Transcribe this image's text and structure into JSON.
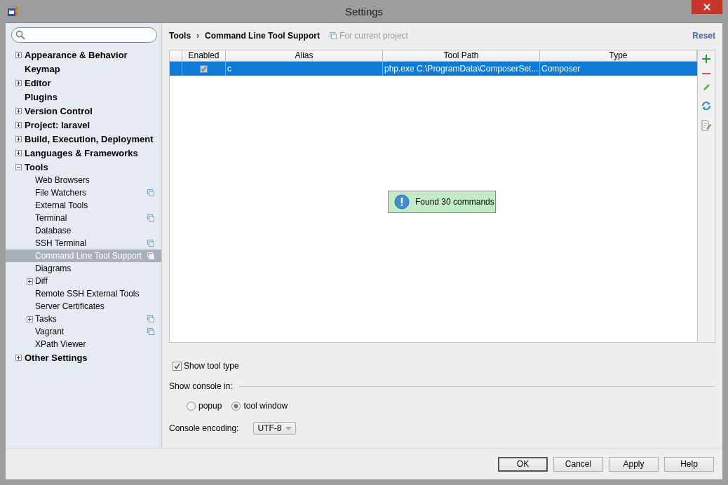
{
  "window": {
    "title": "Settings"
  },
  "sidebar": {
    "items": [
      {
        "label": "Appearance & Behavior",
        "kind": "group",
        "expanded": false,
        "selected": false
      },
      {
        "label": "Keymap",
        "kind": "leaf",
        "selected": false
      },
      {
        "label": "Editor",
        "kind": "group",
        "expanded": false,
        "selected": false
      },
      {
        "label": "Plugins",
        "kind": "leaf",
        "selected": false
      },
      {
        "label": "Version Control",
        "kind": "group",
        "expanded": false,
        "selected": false
      },
      {
        "label": "Project: laravel",
        "kind": "group",
        "expanded": false,
        "selected": false
      },
      {
        "label": "Build, Execution, Deployment",
        "kind": "group",
        "expanded": false,
        "selected": false
      },
      {
        "label": "Languages & Frameworks",
        "kind": "group",
        "expanded": false,
        "selected": false
      },
      {
        "label": "Tools",
        "kind": "group",
        "expanded": true,
        "selected": false,
        "children": [
          {
            "label": "Web Browsers",
            "kind": "leaf",
            "selected": false,
            "per_project": false
          },
          {
            "label": "File Watchers",
            "kind": "leaf",
            "selected": false,
            "per_project": true
          },
          {
            "label": "External Tools",
            "kind": "leaf",
            "selected": false,
            "per_project": false
          },
          {
            "label": "Terminal",
            "kind": "leaf",
            "selected": false,
            "per_project": true
          },
          {
            "label": "Database",
            "kind": "leaf",
            "selected": false,
            "per_project": false
          },
          {
            "label": "SSH Terminal",
            "kind": "leaf",
            "selected": false,
            "per_project": true
          },
          {
            "label": "Command Line Tool Support",
            "kind": "leaf",
            "selected": true,
            "per_project": true
          },
          {
            "label": "Diagrams",
            "kind": "leaf",
            "selected": false,
            "per_project": false
          },
          {
            "label": "Diff",
            "kind": "group",
            "expanded": false,
            "selected": false,
            "per_project": false
          },
          {
            "label": "Remote SSH External Tools",
            "kind": "leaf",
            "selected": false,
            "per_project": false
          },
          {
            "label": "Server Certificates",
            "kind": "leaf",
            "selected": false,
            "per_project": false
          },
          {
            "label": "Tasks",
            "kind": "group",
            "expanded": false,
            "selected": false,
            "per_project": true
          },
          {
            "label": "Vagrant",
            "kind": "leaf",
            "selected": false,
            "per_project": true
          },
          {
            "label": "XPath Viewer",
            "kind": "leaf",
            "selected": false,
            "per_project": false
          }
        ]
      },
      {
        "label": "Other Settings",
        "kind": "group",
        "expanded": false,
        "selected": false
      }
    ]
  },
  "breadcrumb": {
    "parent": "Tools",
    "separator": "›",
    "current": "Command Line Tool Support",
    "scope": "For current project"
  },
  "reset": "Reset",
  "table": {
    "columns": [
      "",
      "Enabled",
      "Alias",
      "Tool Path",
      "Type"
    ],
    "rows": [
      {
        "enabled": true,
        "alias": "c",
        "tool_path": "php.exe C:\\ProgramData\\ComposerSet...",
        "type": "Composer",
        "selected": true
      }
    ]
  },
  "notification": "Found 30 commands",
  "show_tool_type": {
    "label": "Show tool type",
    "checked": true
  },
  "console": {
    "label": "Show console in:",
    "options": [
      {
        "label": "popup",
        "selected": false
      },
      {
        "label": "tool window",
        "selected": true
      }
    ]
  },
  "encoding": {
    "label": "Console encoding:",
    "value": "UTF-8"
  },
  "buttons": [
    {
      "label": "OK",
      "default": true
    },
    {
      "label": "Cancel",
      "default": false
    },
    {
      "label": "Apply",
      "default": false
    },
    {
      "label": "Help",
      "default": false
    }
  ]
}
